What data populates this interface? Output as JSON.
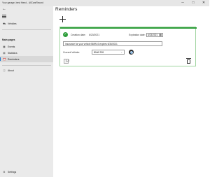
{
  "window": {
    "title": "Your garage, best friend - AllCarsRecord",
    "minimize_glyph": "─",
    "maximize_glyph": "□",
    "close_glyph": "✕"
  },
  "sidebar": {
    "back_icon": "arrow-left-icon",
    "top_items": [
      {
        "label": "Vehicles",
        "icon": "car-icon"
      }
    ],
    "section_label": "Main pages",
    "main_items": [
      {
        "label": "Events",
        "icon": "calendar-icon"
      },
      {
        "label": "Statistics",
        "icon": "chart-icon"
      },
      {
        "label": "Reminders",
        "icon": "reminder-icon",
        "selected": true
      }
    ],
    "about": {
      "label": "About",
      "icon": "info-icon"
    },
    "settings": {
      "label": "Settings",
      "icon": "gear-icon"
    }
  },
  "page": {
    "title": "Reminders"
  },
  "reminder": {
    "status_color": "#2e9e3b",
    "creation_label": "Creation date :",
    "creation_date": "6/20/2021",
    "expiration_label": "Expiration date:",
    "expiration_date": "6/23/2021",
    "description": "Insurance for your vehicle BMW i3 expires 6/30/2021",
    "vehicle_label": "Current Vehicle:",
    "vehicle_value": "BMW 328"
  }
}
